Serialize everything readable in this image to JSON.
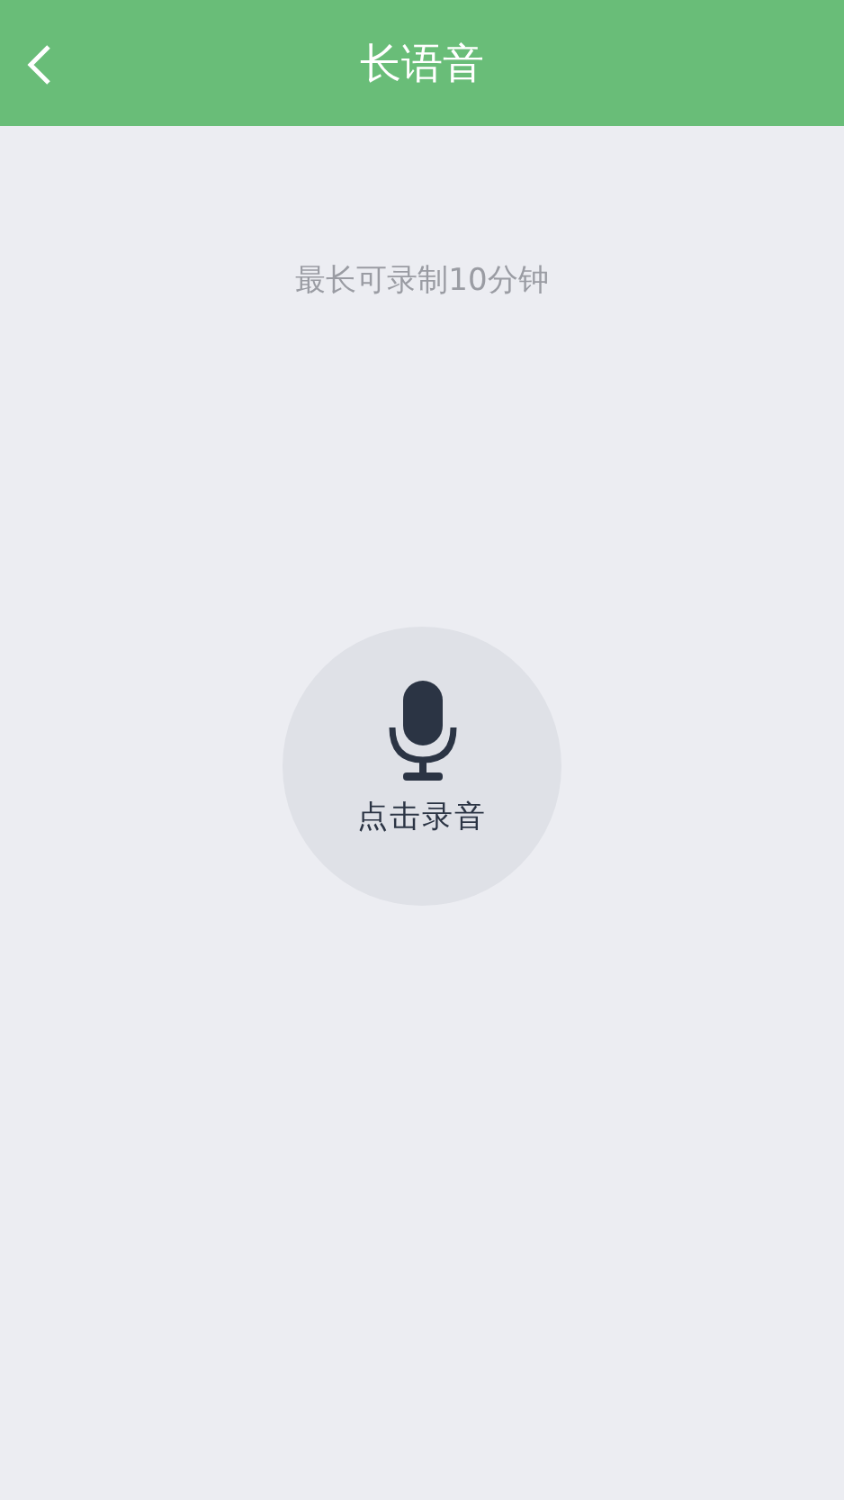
{
  "header": {
    "title": "长语音"
  },
  "hint": "最长可录制10分钟",
  "record_button": {
    "label": "点击录音"
  }
}
